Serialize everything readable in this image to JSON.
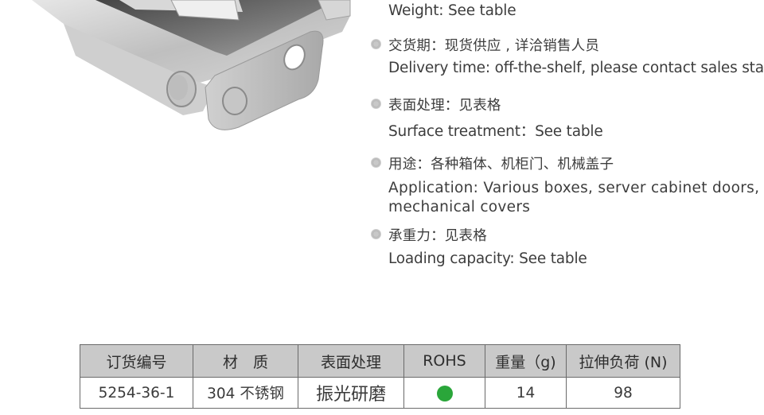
{
  "specs": [
    {
      "id": "weight",
      "zh": "",
      "en": "Weight: See table"
    },
    {
      "id": "delivery",
      "zh": "交货期：现货供应 , 详洽销售人员",
      "en": "Delivery time: off-the-shelf, please contact sales staff"
    },
    {
      "id": "surface",
      "zh": "表面处理：见表格",
      "en": "Surface treatment：See table"
    },
    {
      "id": "application",
      "zh": "用途：各种箱体、机柜门、机械盖子",
      "en": "Application: Various boxes, server cabinet doors, mechanical covers"
    },
    {
      "id": "loading",
      "zh": "承重力：见表格",
      "en": "Loading capacity: See table"
    }
  ],
  "table": {
    "headers": [
      "订货编号",
      "材　质",
      "表面处理",
      "ROHS",
      "重量（g)",
      "拉伸负荷 (N)"
    ],
    "rows": [
      {
        "order_no": "5254-36-1",
        "material": "304 不锈钢",
        "surface": "振光研磨",
        "rohs": "compliant",
        "weight": "14",
        "tensile_load": "98"
      }
    ]
  },
  "colors": {
    "rohs_ok": "#2aa63a",
    "header_bg": "#c9c9c9",
    "border": "#6a6a6a"
  },
  "image": {
    "subject": "stainless-steel-toggle-latch"
  }
}
